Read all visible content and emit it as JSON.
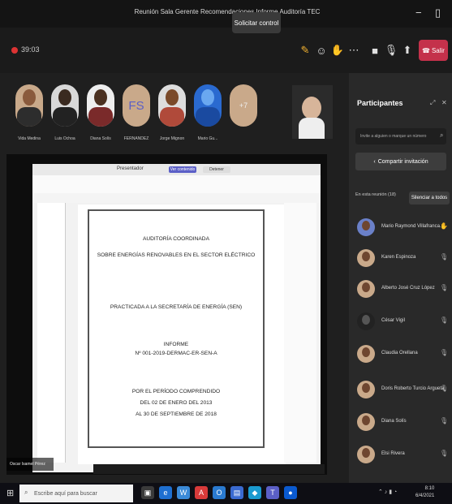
{
  "window": {
    "title": "Reunión Sala Gerente Recomendaciones Informe Auditoría TEC",
    "minimize_icon": "−",
    "maximize_icon": "▯"
  },
  "toolbar": {
    "timer": "39:03",
    "request_control_label": "Solicitar control",
    "leave_label": "Salir",
    "icons": [
      "chat-icon",
      "reactions-icon",
      "raise-hand-icon",
      "more-icon",
      "camera-icon",
      "mic-icon",
      "share-icon"
    ],
    "leave_color": "#c4314b"
  },
  "participants_strip": [
    {
      "name": "Vida Medina"
    },
    {
      "name": "Luis Ochoa"
    },
    {
      "name": "Diana Solís"
    },
    {
      "name": "FERNANDEZ",
      "initials": "FS"
    },
    {
      "name": "Jorge Mignon"
    },
    {
      "name": "Mario Gu..."
    },
    {
      "name": "+7",
      "more": true
    }
  ],
  "shared_screen": {
    "toolbar_label": "Presentador",
    "btn1": "Ver contenido",
    "btn2": "Detener",
    "presenter_caption": "Oscar Isamel Pérez",
    "doc": {
      "title1": "AUDITORÍA COORDINADA",
      "title2": "SOBRE ENERGÍAS RENOVABLES EN EL SECTOR ELÉCTRICO",
      "practiced": "PRACTICADA A LA SECRETARÍA DE ENERGÍA (SEN)",
      "report": "INFORME",
      "report_no": "Nº 001-2019-DERMAC-ER-SEN-A",
      "period1": "POR EL PERÍODO COMPRENDIDO",
      "period2": "DEL 02 DE ENERO DEL 2013",
      "period3": "AL 30 DE SEPTIEMBRE DE 2018"
    }
  },
  "panel": {
    "title": "Participantes",
    "invite_placeholder": "Invite a alguien o marque un número",
    "share_invite_label": "Compartir invitación",
    "section_label": "En esta reunión (18)",
    "mute_all_label": "Silenciar a todos",
    "people": [
      {
        "name": "Mario Raymond Villafranca..."
      },
      {
        "name": "Karen Espinoza"
      },
      {
        "name": "Alberto José Cruz López"
      },
      {
        "name": "César Vigil"
      },
      {
        "name": "Claudia Orellana"
      },
      {
        "name": "Doris Roberto Turcio Argueta"
      },
      {
        "name": "Diana Solís"
      },
      {
        "name": "Elsi Rivera"
      }
    ]
  },
  "taskbar": {
    "search_placeholder": "Escribe aquí para buscar",
    "time": "8:10",
    "date": "6/4/2021"
  }
}
